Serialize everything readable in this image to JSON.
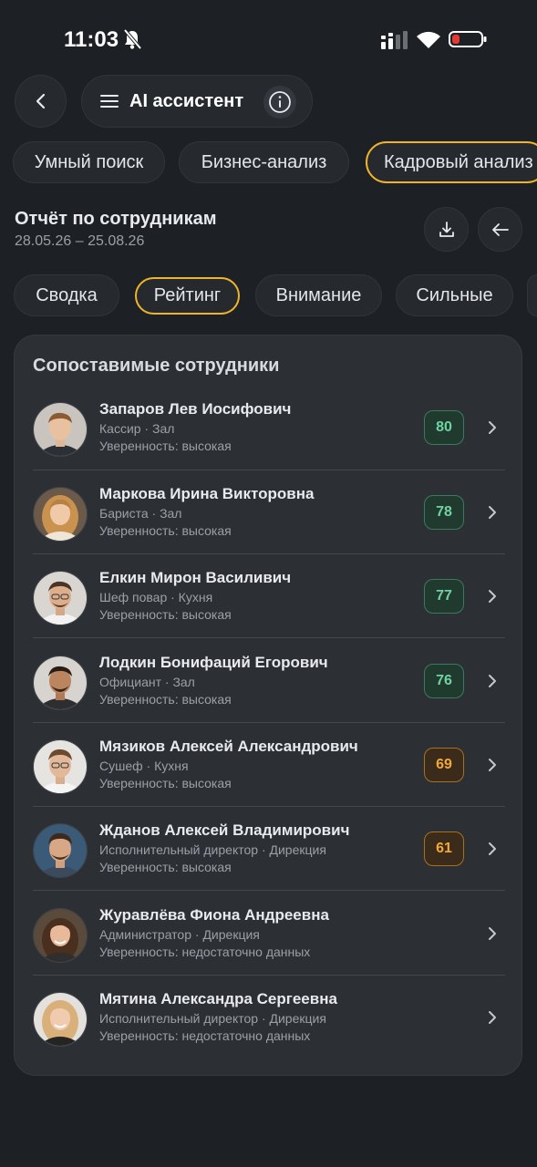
{
  "status": {
    "time": "11:03"
  },
  "header": {
    "title": "AI ассистент"
  },
  "mode_tabs": [
    {
      "label": "Умный поиск",
      "active": false
    },
    {
      "label": "Бизнес-анализ",
      "active": false
    },
    {
      "label": "Кадровый анализ",
      "active": true
    }
  ],
  "report": {
    "title": "Отчёт по сотрудникам",
    "dates": "28.05.26 – 25.08.26"
  },
  "sub_tabs": [
    {
      "label": "Сводка",
      "active": false
    },
    {
      "label": "Рейтинг",
      "active": true
    },
    {
      "label": "Внимание",
      "active": false
    },
    {
      "label": "Сильные",
      "active": false
    }
  ],
  "card": {
    "title": "Сопоставимые сотрудники",
    "employees": [
      {
        "name": "Запаров Лев Иосифович",
        "role": "Кассир · Зал",
        "confidence": "Уверенность: высокая",
        "score": "80",
        "score_level": "green"
      },
      {
        "name": "Маркова Ирина Викторовна",
        "role": "Бариста · Зал",
        "confidence": "Уверенность: высокая",
        "score": "78",
        "score_level": "green"
      },
      {
        "name": "Елкин Мирон Василивич",
        "role": "Шеф повар · Кухня",
        "confidence": "Уверенность: высокая",
        "score": "77",
        "score_level": "green"
      },
      {
        "name": "Лодкин Бонифаций Егорович",
        "role": "Официант · Зал",
        "confidence": "Уверенность: высокая",
        "score": "76",
        "score_level": "green"
      },
      {
        "name": "Мязиков Алексей Александрович",
        "role": "Сушеф · Кухня",
        "confidence": "Уверенность: высокая",
        "score": "69",
        "score_level": "orange"
      },
      {
        "name": "Жданов Алексей Владимирович",
        "role": "Исполнительный директор · Дирекция",
        "confidence": "Уверенность: высокая",
        "score": "61",
        "score_level": "orange"
      },
      {
        "name": "Журавлёва Фиона Андреевна",
        "role": "Администратор · Дирекция",
        "confidence": "Уверенность: недостаточно данных",
        "score": "",
        "score_level": "none"
      },
      {
        "name": "Мятина Александра Сергеевна",
        "role": "Исполнительный директор · Дирекция",
        "confidence": "Уверенность: недостаточно данных",
        "score": "",
        "score_level": "none"
      }
    ]
  },
  "colors": {
    "accent": "#f0b429",
    "score_green": "#6fd3a1",
    "score_orange": "#f3a838",
    "background": "#1d2024",
    "card": "#2c3035"
  }
}
